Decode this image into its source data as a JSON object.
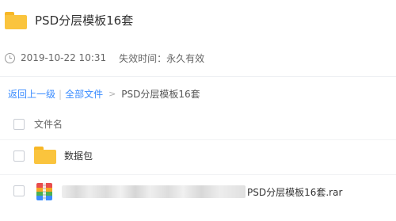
{
  "share": {
    "title": "PSD分层模板16套",
    "date": "2019-10-22 10:31",
    "expiry": "失效时间：永久有效"
  },
  "breadcrumb": {
    "back": "返回上一级",
    "separator": "|",
    "all_files": "全部文件",
    "arrow": ">",
    "current": "PSD分层模板16套"
  },
  "table": {
    "column_name": "文件名",
    "rows": [
      {
        "type": "folder",
        "name": "数据包"
      },
      {
        "type": "rar",
        "name": "PSD分层模板16套.rar"
      }
    ]
  },
  "colors": {
    "link": "#3b8cff",
    "folder": "#fac43d"
  },
  "icons": [
    "folder-icon",
    "clock-icon",
    "checkbox-icon",
    "rar-file-icon"
  ]
}
